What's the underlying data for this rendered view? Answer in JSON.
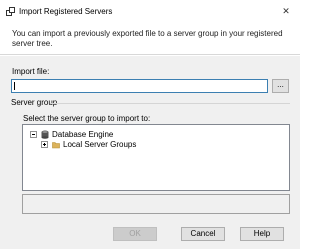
{
  "window": {
    "title": "Import Registered Servers",
    "app_icon": "server-registration-icon",
    "close_glyph": "✕"
  },
  "banner": {
    "text": "You can import a previously exported file to a server group in your registered server tree."
  },
  "import_file": {
    "label": "Import file:",
    "value": "",
    "browse_label": "..."
  },
  "server_group": {
    "label": "Server group",
    "select_label": "Select the server group to import to:",
    "tree": [
      {
        "label": "Database Engine",
        "icon": "database-icon",
        "expanded": true
      },
      {
        "label": "Local Server Groups",
        "icon": "folder-icon",
        "expanded": false
      }
    ]
  },
  "buttons": {
    "ok": "OK",
    "cancel": "Cancel",
    "help": "Help"
  },
  "colors": {
    "input_focus_border": "#3c7fb1",
    "folder": "#dcb35c",
    "body_bg": "#f0f0f0"
  }
}
